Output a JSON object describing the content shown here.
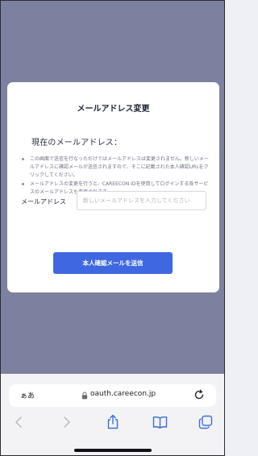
{
  "modal": {
    "title": "メールアドレス変更",
    "current_email_label": "現在のメールアドレス：",
    "notes": [
      "この画面で送信を行なっただけではメールアドレスは変更されません。新しいメールアドレスに確認メールが送信されますので、そこに記載された本人確認URLをクリックしてください。",
      "メールアドレスの変更を行うと、CAREECON IDを使用してログインする各サービスのメールアドレスも変更されます。"
    ],
    "email_field_label": "メールアドレス",
    "email_placeholder": "新しいメールアドレスを入力してください",
    "submit_label": "本人確認メールを送信"
  },
  "browser": {
    "aa_label": "ぁあ",
    "url": "oauth.careecon.jp",
    "icons": [
      "lock-icon",
      "reload-icon",
      "back-icon",
      "forward-icon",
      "share-icon",
      "bookmarks-icon",
      "tabs-icon"
    ]
  },
  "colors": {
    "overlay": "#7c819f",
    "primary_button": "#3f68e0",
    "modal_bg": "#ffffff"
  }
}
